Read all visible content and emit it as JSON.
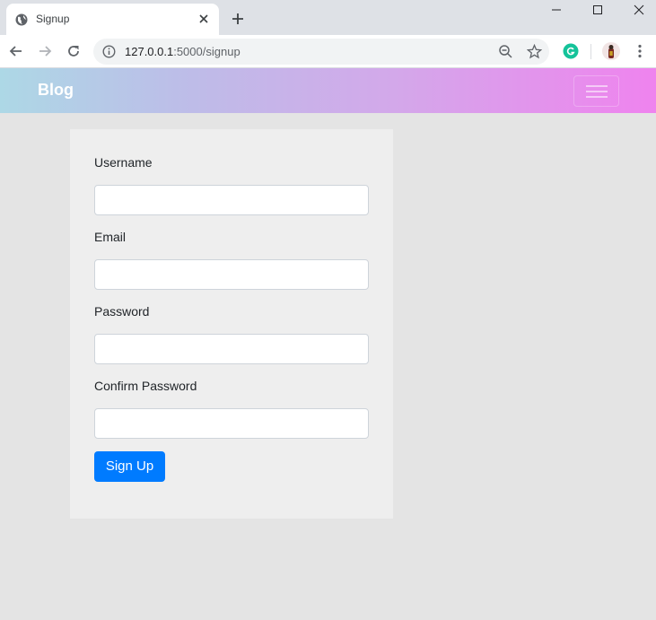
{
  "browser": {
    "tab_title": "Signup",
    "url_host": "127.0.0.1",
    "url_path": ":5000/signup"
  },
  "navbar": {
    "brand": "Blog"
  },
  "form": {
    "fields": [
      {
        "label": "Username",
        "value": ""
      },
      {
        "label": "Email",
        "value": ""
      },
      {
        "label": "Password",
        "value": ""
      },
      {
        "label": "Confirm Password",
        "value": ""
      }
    ],
    "submit_label": "Sign Up"
  },
  "colors": {
    "primary_button": "#007bff",
    "navbar_gradient_start": "#add8e6",
    "navbar_gradient_end": "#ef83ee"
  },
  "icons": [
    "globe-icon",
    "close-icon",
    "plus-icon",
    "minimize-icon",
    "maximize-icon",
    "window-close-icon",
    "back-icon",
    "forward-icon",
    "reload-icon",
    "info-icon",
    "zoom-out-icon",
    "star-icon",
    "grammarly-icon",
    "profile-avatar",
    "more-icon",
    "hamburger-icon"
  ]
}
